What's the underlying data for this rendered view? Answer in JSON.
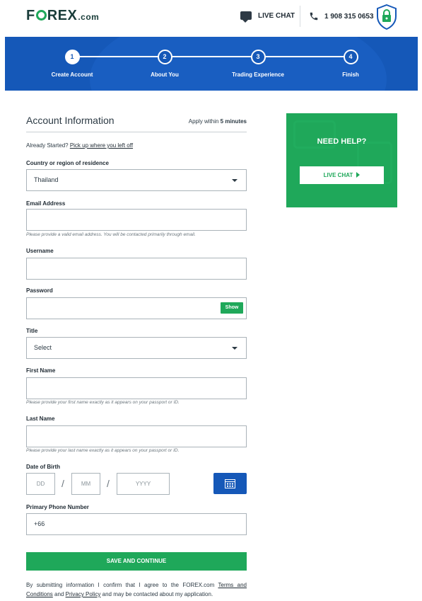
{
  "header": {
    "logo_main": "F",
    "logo_rest": "REX",
    "logo_suffix": ".com",
    "live_chat": "LIVE CHAT",
    "phone": "1 908 315 0653"
  },
  "steps": [
    {
      "number": "1",
      "label": "Create Account",
      "active": true
    },
    {
      "number": "2",
      "label": "About You",
      "active": false
    },
    {
      "number": "3",
      "label": "Trading Experience",
      "active": false
    },
    {
      "number": "4",
      "label": "Finish",
      "active": false
    }
  ],
  "form": {
    "title": "Account Information",
    "apply_prefix": "Apply within ",
    "apply_time": "5 minutes",
    "already_text": "Already Started? ",
    "already_link": "Pick up where you left off",
    "country_label": "Country or region of residence",
    "country_value": "Thailand",
    "email_label": "Email Address",
    "email_value": "",
    "email_hint": "Please provide a valid email address. You will be contacted primarily through email.",
    "username_label": "Username",
    "username_value": "",
    "password_label": "Password",
    "password_value": "",
    "show_label": "Show",
    "title_label": "Title",
    "title_value": "Select",
    "firstname_label": "First Name",
    "firstname_value": "",
    "firstname_hint": "Please provide your first name exactly as it appears on your passport or ID.",
    "lastname_label": "Last Name",
    "lastname_value": "",
    "lastname_hint": "Please provide your last name exactly as it appears on your passport or ID.",
    "dob_label": "Date of Birth",
    "dob_dd": "DD",
    "dob_mm": "MM",
    "dob_yyyy": "YYYY",
    "dob_sep": "/",
    "phone_label": "Primary Phone Number",
    "phone_value": "+66",
    "submit_label": "SAVE AND CONTINUE",
    "legal_1": "By submitting information I confirm that I agree to the FOREX.com ",
    "legal_terms": "Terms and Conditions",
    "legal_and": " and ",
    "legal_privacy": "Privacy Policy",
    "legal_2": " and may be contacted about my application."
  },
  "help": {
    "title": "NEED HELP?",
    "button": "LIVE CHAT"
  },
  "colors": {
    "brand_blue": "#1558b8",
    "brand_green": "#1fa85a"
  }
}
